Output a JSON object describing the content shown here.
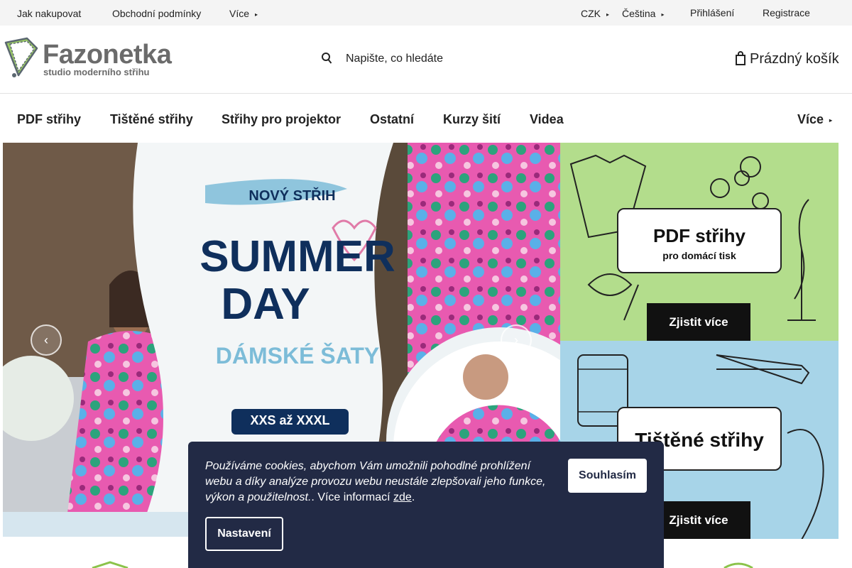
{
  "topbar": {
    "how_to_shop": "Jak nakupovat",
    "terms": "Obchodní podmínky",
    "more": "Více",
    "currency": "CZK",
    "language": "Čeština",
    "login": "Přihlášení",
    "register": "Registrace"
  },
  "header": {
    "logo_name": "Fazonetka",
    "logo_tagline": "studio moderního střihu",
    "search_placeholder": "Napište, co hledáte",
    "cart_label": "Prázdný košík"
  },
  "nav": {
    "items": [
      "PDF střihy",
      "Tištěné střihy",
      "Střihy pro projektor",
      "Ostatní",
      "Kurzy šití",
      "Videa"
    ],
    "more": "Více"
  },
  "hero": {
    "badge": "NOVÝ STŘIH",
    "title_line1": "SUMMER",
    "title_line2": "DAY",
    "subtitle": "DÁMSKÉ ŠATY",
    "sizes": "XXS až XXXL"
  },
  "banners": [
    {
      "title": "PDF střihy",
      "subtitle": "pro domácí tisk",
      "cta": "Zjistit více"
    },
    {
      "title": "Tištěné střihy",
      "subtitle": "",
      "cta": "Zjistit více"
    }
  ],
  "cookie": {
    "text": "Používáme cookies, abychom Vám umožnili pohodlné prohlížení webu a díky analýze provozu webu neustále zlepšovali jeho funkce, výkon a použitelnost.",
    "more_prefix": ". Více informací ",
    "more_link": "zde",
    "more_suffix": ".",
    "accept": "Souhlasím",
    "settings": "Nastavení"
  },
  "colors": {
    "brand_green": "#8bc34a",
    "brand_gray": "#6b6b6b",
    "cookie_bg": "#222a45",
    "banner1_bg": "#b3dd8c",
    "banner2_bg": "#a7d4e8",
    "hero_title": "#0f2f5c",
    "hero_subtitle": "#7cbcd8"
  }
}
